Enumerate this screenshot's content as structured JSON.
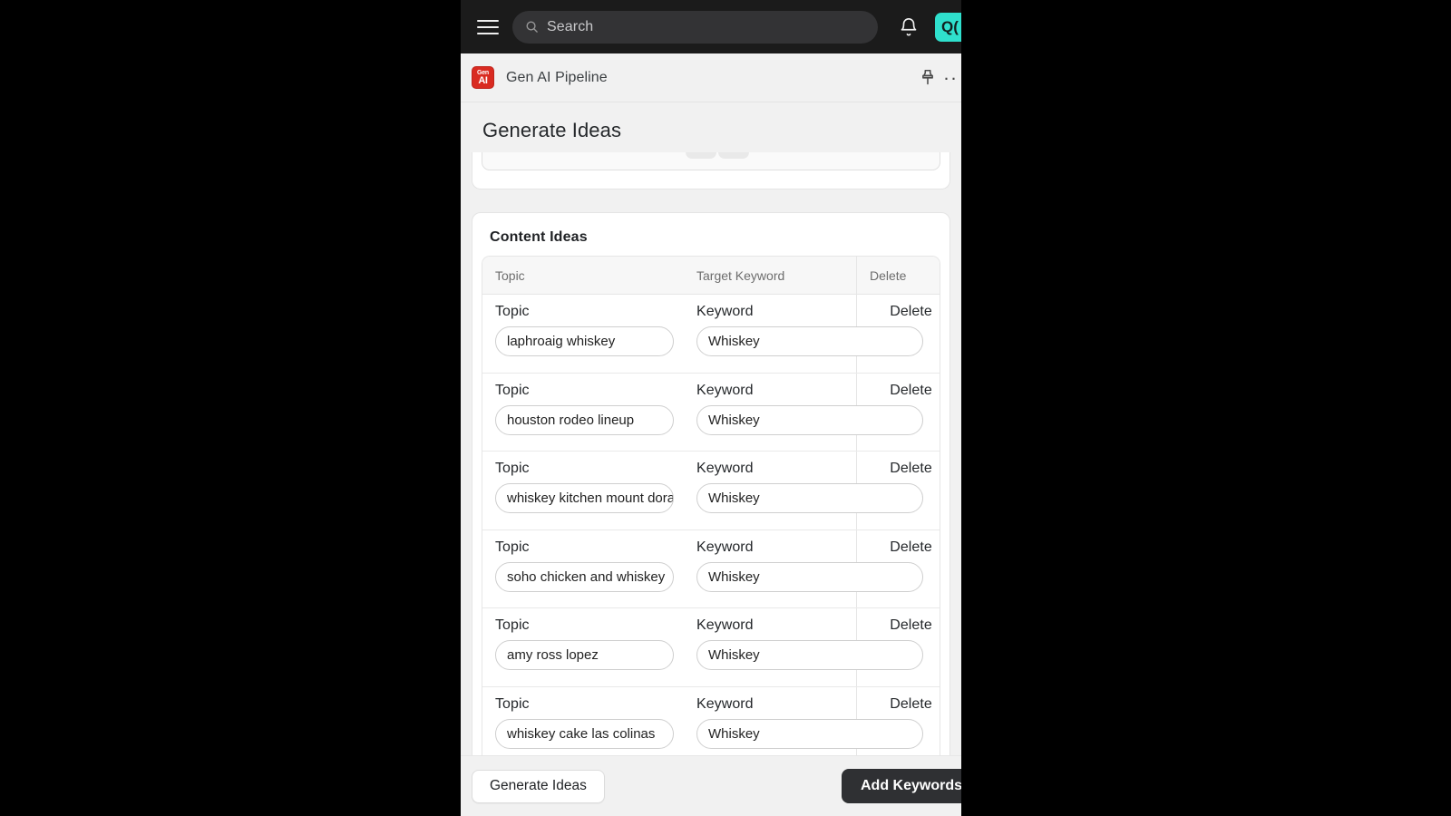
{
  "topbar": {
    "menu_icon": "hamburger-icon",
    "search": {
      "placeholder": "Search",
      "value": "",
      "icon": "search-icon"
    },
    "notifications_icon": "bell-icon",
    "avatar_label": "Q("
  },
  "appheader": {
    "logo_line1": "Gen",
    "logo_line2": "AI",
    "app_name": "Gen AI Pipeline",
    "pin_icon": "pin-icon",
    "more_label": "··"
  },
  "page": {
    "title": "Generate Ideas"
  },
  "content_ideas": {
    "card_title": "Content Ideas",
    "columns": [
      "Topic",
      "Target Keyword",
      "Delete"
    ],
    "row_labels": {
      "topic": "Topic",
      "keyword": "Keyword",
      "delete": "Delete"
    },
    "rows": [
      {
        "topic": "laphroaig whiskey",
        "keyword": "Whiskey"
      },
      {
        "topic": "houston rodeo lineup",
        "keyword": "Whiskey"
      },
      {
        "topic": "whiskey kitchen mount dora",
        "keyword": "Whiskey"
      },
      {
        "topic": "soho chicken and whiskey",
        "keyword": "Whiskey"
      },
      {
        "topic": "amy ross lopez",
        "keyword": "Whiskey"
      },
      {
        "topic": "whiskey cake las colinas",
        "keyword": "Whiskey"
      }
    ]
  },
  "bottombar": {
    "generate_label": "Generate Ideas",
    "add_keywords_label": "Add Keywords"
  },
  "colors": {
    "topbar_bg": "#1b1b1b",
    "search_bg": "#333335",
    "avatar_bg": "#2fe0cd",
    "logo_red": "#d92b21",
    "page_bg": "#f1f1f1",
    "primary_button_bg": "#2f3033"
  }
}
